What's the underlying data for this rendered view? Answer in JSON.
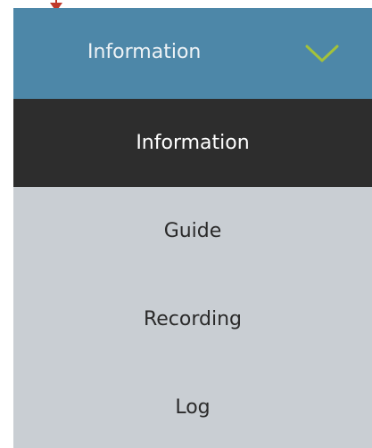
{
  "header": {
    "label": "Information",
    "chevron_icon": "chevron-down-icon",
    "accent_color": "#4d87a8",
    "chevron_color": "#a4c23a"
  },
  "menu": {
    "items": [
      {
        "label": "Information",
        "active": true
      },
      {
        "label": "Guide",
        "active": false
      },
      {
        "label": "Recording",
        "active": false
      },
      {
        "label": "Log",
        "active": false
      }
    ]
  },
  "pointer": {
    "icon": "arrow-down-icon",
    "color": "#c0392b"
  }
}
